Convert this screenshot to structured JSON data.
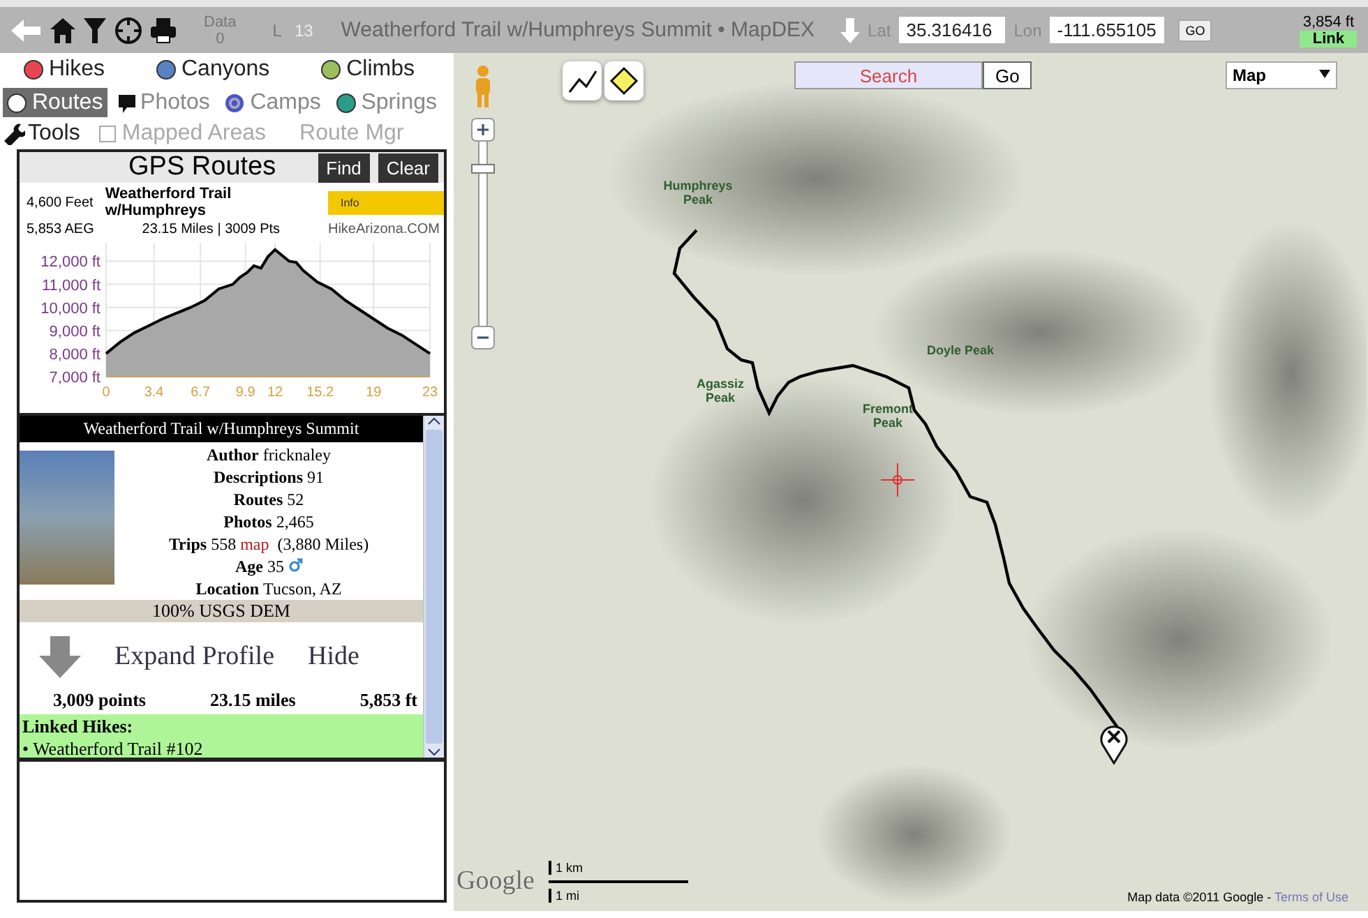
{
  "toolbar": {
    "data_label": "Data",
    "data_value": "0",
    "level_label": "L",
    "level_value": "13",
    "title": "Weatherford Trail w/Humphreys Summit • MapDEX",
    "lat_label": "Lat",
    "lat": "35.316416",
    "lon_label": "Lon",
    "lon": "-111.655105",
    "go": "GO",
    "elevation": "3,854 ft",
    "link": "Link"
  },
  "layer_rows": [
    [
      {
        "kind": "dot",
        "label": "Hikes",
        "color": "#e84552",
        "selected": false
      },
      {
        "kind": "dot",
        "label": "Canyons",
        "color": "#5a82c0",
        "selected": false
      },
      {
        "kind": "dot",
        "label": "Climbs",
        "color": "#9cbf5e",
        "selected": false
      }
    ],
    [
      {
        "kind": "dot",
        "label": "Routes",
        "color": "#ffffff",
        "selected": true
      },
      {
        "kind": "photo",
        "label": "Photos",
        "selected": false
      },
      {
        "kind": "target",
        "label": "Camps",
        "color": "#4a55c8",
        "selected": false
      },
      {
        "kind": "dot",
        "label": "Springs",
        "color": "#2a9c8c",
        "selected": false
      }
    ]
  ],
  "tools": {
    "label": "Tools",
    "mapped_areas": {
      "label": "Mapped Areas",
      "checked": false
    },
    "route_mgr": "Route Mgr"
  },
  "gps_routes": {
    "title": "GPS Routes",
    "buttons": [
      "Find",
      "Clear"
    ],
    "elevation": "4,600 Feet",
    "aeg": "5,853 AEG",
    "route_name": "Weatherford Trail w/Humphreys",
    "info": "Info",
    "summary": "23.15 Miles | 3009 Pts",
    "source": "HikeArizona.COM",
    "chart_data": {
      "type": "area",
      "x": [
        0,
        1,
        2,
        3,
        4,
        5,
        6,
        7,
        8,
        9,
        9.5,
        10,
        10.5,
        11,
        11.5,
        12,
        13,
        13.5,
        14,
        15,
        16,
        17,
        18,
        19,
        20,
        21,
        22,
        23
      ],
      "grid": true,
      "series": [
        {
          "color": "#000000",
          "values": [
            8000,
            8500,
            8900,
            9200,
            9500,
            9750,
            10000,
            10300,
            10800,
            11000,
            11300,
            11500,
            11800,
            11700,
            12200,
            12500,
            12000,
            11950,
            11600,
            11100,
            10800,
            10300,
            9900,
            9500,
            9100,
            8800,
            8400,
            8000
          ]
        }
      ],
      "xlim": [
        0,
        23
      ],
      "ylim": [
        7000,
        12800
      ],
      "xticks": [
        0,
        {
          "value": 3.4,
          "label": "3.4"
        },
        {
          "value": 6.7,
          "label": "6.7"
        },
        {
          "value": 9.9,
          "label": "9.9"
        },
        12,
        {
          "value": 15.2,
          "label": "15.2"
        },
        19,
        23
      ],
      "yticks": [
        {
          "value": 7000,
          "label": "7,000 ft"
        },
        {
          "value": 8000,
          "label": "8,000 ft"
        },
        {
          "value": 9000,
          "label": "9,000 ft"
        },
        {
          "value": 10000,
          "label": "10,000 ft"
        },
        {
          "value": 11000,
          "label": "11,000 ft"
        },
        {
          "value": 12000,
          "label": "12,000 ft"
        }
      ]
    }
  },
  "profile": {
    "header": "Weatherford Trail w/Humphreys Summit",
    "fields": [
      {
        "kind": "text",
        "label": "Author",
        "value": "fricknaley"
      },
      {
        "kind": "text",
        "label": "Descriptions",
        "value": "91"
      },
      {
        "kind": "text",
        "label": "Routes",
        "value": "52"
      },
      {
        "kind": "text",
        "label": "Photos",
        "value": "2,465"
      },
      {
        "kind": "link",
        "label": "Trips",
        "value": "558",
        "link": "map",
        "note": "(3,880 Miles)"
      },
      {
        "kind": "male",
        "label": "Age",
        "value": "35"
      },
      {
        "kind": "text",
        "label": "Location",
        "value": "Tucson, AZ"
      }
    ],
    "dem": "100% USGS DEM",
    "expand": "Expand Profile",
    "hide": "Hide",
    "stats": [
      "3,009 points",
      "23.15 miles",
      "5,853 ft"
    ],
    "linked_title": "Linked Hikes:",
    "linked": [
      "• Weatherford Trail #102"
    ]
  },
  "map": {
    "search_placeholder": "Search",
    "go": "Go",
    "type": "Map",
    "zoom": {
      "level": 0.85
    },
    "peaks": [
      "Humphreys Peak",
      "Agassiz Peak",
      "Fremont Peak",
      "Doyle Peak"
    ],
    "logo": "Google",
    "scale": [
      "1 km",
      "1 mi"
    ],
    "attribution": "Map data ©2011 Google - ",
    "terms": "Terms of Use"
  }
}
